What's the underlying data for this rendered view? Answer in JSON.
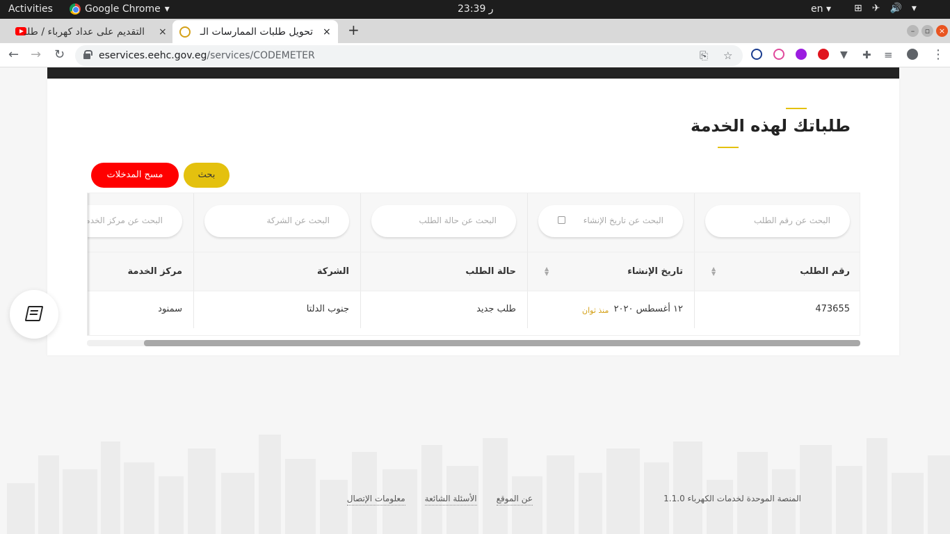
{
  "os_bar": {
    "activities": "Activities",
    "app_name": "Google Chrome",
    "clock": "ر 23:39",
    "language": "en"
  },
  "browser": {
    "tabs": [
      {
        "title": "التقديم على عداد كهرباء / طلـ",
        "close": "×"
      },
      {
        "title": "تحويل طلبات الممارسات الـ",
        "close": "×"
      }
    ],
    "new_tab": "+",
    "url_host": "eservices.eehc.gov.eg",
    "url_path": "/services/CODEMETER"
  },
  "page": {
    "title": "طلباتك لهذه الخدمة",
    "buttons": {
      "search": "بحث",
      "clear": "مسح المدخلات"
    },
    "filters": {
      "request_number": "البحث عن رقم الطلب",
      "creation_date": "البحث عن تاريخ الإنشاء",
      "request_status": "البحث عن حالة الطلب",
      "company": "البحث عن الشركة",
      "service_center": "البحث عن مركز الخدمة"
    },
    "columns": [
      "رقم الطلب",
      "تاريخ الإنشاء",
      "حالة الطلب",
      "الشركة",
      "مركز الخدمة"
    ],
    "rows": [
      {
        "request_number": "473655",
        "creation_date": "١٢ أغسطس ٢٠٢٠",
        "since": "منذ ثوان",
        "status": "طلب جديد",
        "company": "جنوب الدلتا",
        "service_center": "سمنود"
      }
    ],
    "scroll_fraction": 0.926
  },
  "footer": {
    "brand": "المنصة الموحدة لخدمات الكهرباء 1.1.0",
    "links": [
      "عن الموقع",
      "الأسئلة الشائعة",
      "معلومات الإتصال"
    ]
  },
  "colors": {
    "accent": "#e4c10e",
    "clear_button": "#ff0000",
    "dark_band": "#222222"
  }
}
